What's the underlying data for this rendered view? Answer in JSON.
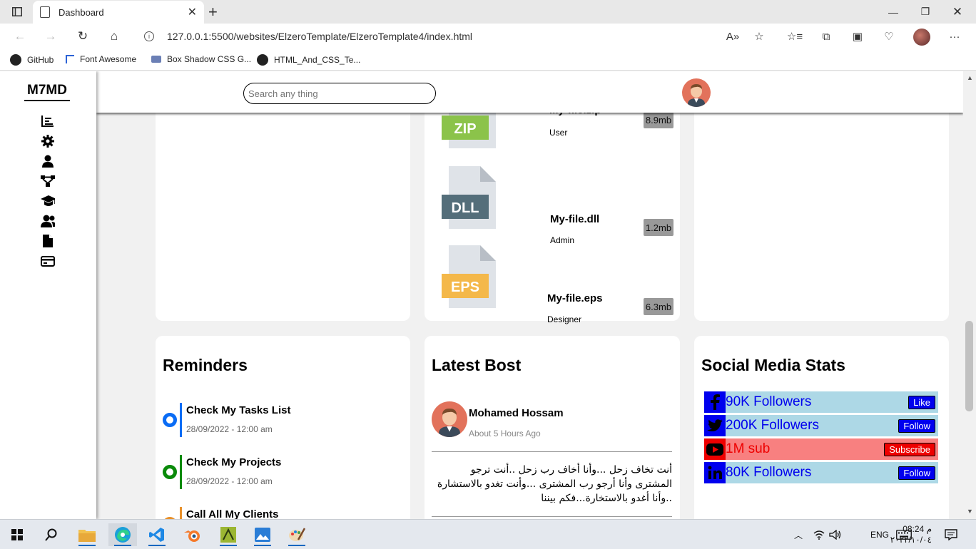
{
  "browser": {
    "tab_title": "Dashboard",
    "url": "127.0.0.1:5500/websites/ElzeroTemplate/ElzeroTemplate4/index.html",
    "favorites": [
      "GitHub",
      "Font Awesome",
      "Box Shadow CSS G...",
      "HTML_And_CSS_Te..."
    ]
  },
  "sidebar": {
    "logo": "M7MD",
    "icons": [
      "chart-bar-icon",
      "gear-icon",
      "user-icon",
      "diagram-icon",
      "graduation-cap-icon",
      "users-icon",
      "file-icon",
      "credit-card-icon"
    ]
  },
  "header": {
    "search_placeholder": "Search any thing"
  },
  "files": [
    {
      "ext": "ZIP",
      "name": "My-file.zip",
      "role": "User",
      "size": "8.9mb",
      "color": "#8bc34a"
    },
    {
      "ext": "DLL",
      "name": "My-file.dll",
      "role": "Admin",
      "size": "1.2mb",
      "color": "#546e7a"
    },
    {
      "ext": "EPS",
      "name": "My-file.eps",
      "role": "Designer",
      "size": "6.3mb",
      "color": "#f4b84a"
    }
  ],
  "reminders": {
    "title": "Reminders",
    "items": [
      {
        "title": "Check My Tasks List",
        "date": "28/09/2022 - 12:00 am",
        "color": "#0a6cf5"
      },
      {
        "title": "Check My Projects",
        "date": "28/09/2022 - 12:00 am",
        "color": "#0a8a0a"
      },
      {
        "title": "Call All My Clients",
        "date": "",
        "color": "#e8912c"
      }
    ]
  },
  "latest_post": {
    "title": "Latest Bost",
    "author": "Mohamed Hossam",
    "time": "About 5 Hours Ago",
    "text": "أنت تخاف زحل ...وأنا أخاف رب زحل ..أنت ترجو المشترى وأنا أرجو رب المشترى ...وأنت تغدو بالاستشارة ..وأنا أغدو بالاستخارة...فكم بيننا"
  },
  "social": {
    "title": "Social Media Stats",
    "items": [
      {
        "icon": "facebook-icon",
        "text": "90K Followers",
        "button": "Like",
        "bg": "#add8e6",
        "fg": "#0000ee",
        "btn_bg": "#0000ee"
      },
      {
        "icon": "twitter-icon",
        "text": "200K Followers",
        "button": "Follow",
        "bg": "#add8e6",
        "fg": "#0000ee",
        "btn_bg": "#0000ee"
      },
      {
        "icon": "youtube-icon",
        "text": "1M sub",
        "button": "Subscribe",
        "bg": "#f88080",
        "fg": "#ee0000",
        "btn_bg": "#ee0000"
      },
      {
        "icon": "linkedin-icon",
        "text": "80K Followers",
        "button": "Follow",
        "bg": "#add8e6",
        "fg": "#0000ee",
        "btn_bg": "#0000ee"
      }
    ]
  },
  "taskbar": {
    "lang": "ENG",
    "time": "08:24 م",
    "date": "٢٠٢٢/١٠/٠٤"
  }
}
